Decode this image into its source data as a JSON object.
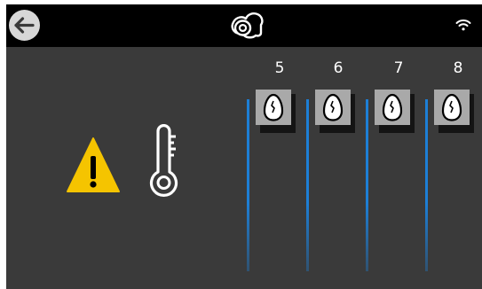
{
  "header": {
    "back_icon": "arrow-left-icon",
    "center_icon": "egg-chamber-icon",
    "status_icon": "wifi-icon"
  },
  "alert": {
    "warning_icon": "warning-triangle-icon",
    "sensor_icon": "thermometer-icon"
  },
  "columns": [
    {
      "number": "5",
      "icon": "egg-icon"
    },
    {
      "number": "6",
      "icon": "egg-icon"
    },
    {
      "number": "7",
      "icon": "egg-icon"
    },
    {
      "number": "8",
      "icon": "egg-icon"
    }
  ],
  "colors": {
    "background": "#3a3a3a",
    "topbar": "#000000",
    "warning": "#f5c400",
    "tile": "#a9a9a9",
    "line": "#1d7fd6"
  }
}
